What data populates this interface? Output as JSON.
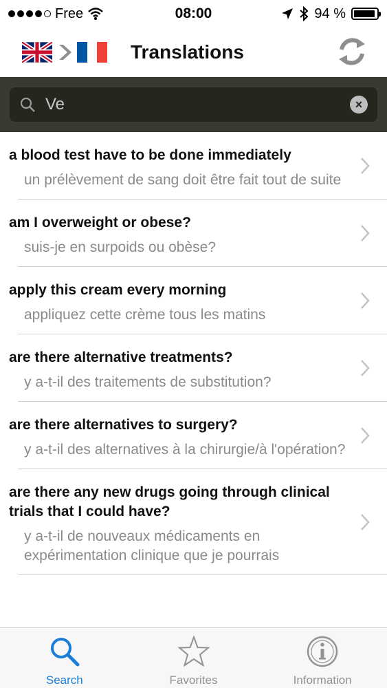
{
  "status_bar": {
    "carrier": "Free",
    "time": "08:00",
    "battery_percent": "94 %",
    "battery_level": 0.94
  },
  "nav": {
    "title": "Translations",
    "source_flag": "uk-flag",
    "target_flag": "france-flag",
    "swap_icon": "swap-arrows-icon"
  },
  "search": {
    "value": "Ve",
    "clear_label": "×"
  },
  "rows": [
    {
      "title": "a blood test have to be done immediately",
      "translation": "un prélèvement de sang doit être fait tout de suite"
    },
    {
      "title": "am I overweight or obese?",
      "translation": "suis-je en surpoids ou obèse?"
    },
    {
      "title": "apply this cream every morning",
      "translation": "appliquez cette crème tous les matins"
    },
    {
      "title": "are there alternative treatments?",
      "translation": "y a-t-il des traitements de substitution?"
    },
    {
      "title": "are there alternatives to surgery?",
      "translation": "y a-t-il des alternatives à la chirurgie/à l'opération?"
    },
    {
      "title": "are there any new drugs going through clinical trials that I could have?",
      "translation": "y a-t-il de nouveaux médicaments en expérimentation clinique que je pourrais"
    }
  ],
  "tabs": [
    {
      "label": "Search",
      "icon": "search-icon",
      "active": true
    },
    {
      "label": "Favorites",
      "icon": "star-icon",
      "active": false
    },
    {
      "label": "Information",
      "icon": "info-icon",
      "active": false
    }
  ],
  "colors": {
    "accent": "#1a7ed8",
    "search_bg": "#3a3a32",
    "inactive": "#929292"
  }
}
